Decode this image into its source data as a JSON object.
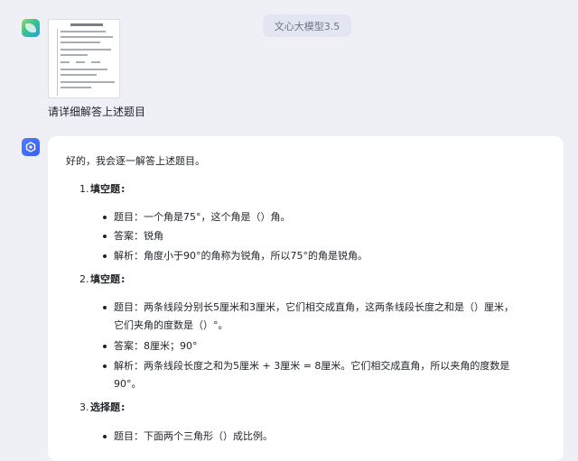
{
  "header": {
    "model_name": "文心大模型3.5"
  },
  "user": {
    "message": "请详细解答上述题目",
    "avatar_icon": "user-avatar-icon",
    "attachment_icon": "worksheet-thumbnail"
  },
  "bot": {
    "avatar_icon": "ernie-logo-icon",
    "intro": "好的，我会逐一解答上述题目。",
    "q1": {
      "number": "1.",
      "type": "填空题",
      "colon": ":",
      "question": "题目：一个角是75°，这个角是（）角。",
      "answer": "答案：锐角",
      "analysis": "解析：角度小于90°的角称为锐角，所以75°的角是锐角。"
    },
    "q2": {
      "number": "2.",
      "type": "填空题",
      "colon": ":",
      "question_line1": "题目：两条线段分别长5厘米和3厘米，它们相交成直角，这两条线段长度之和是（）厘米，",
      "question_line2": "它们夹角的度数是（）°。",
      "answer": "答案：8厘米；90°",
      "analysis_line1": "解析：两条线段长度之和为5厘米 + 3厘米 = 8厘米。它们相交成直角，所以夹角的度数是",
      "analysis_line2": "90°。"
    },
    "q3": {
      "number": "3.",
      "type": "选择题",
      "colon": ":",
      "question": "题目：下面两个三角形（）成比例。"
    }
  }
}
